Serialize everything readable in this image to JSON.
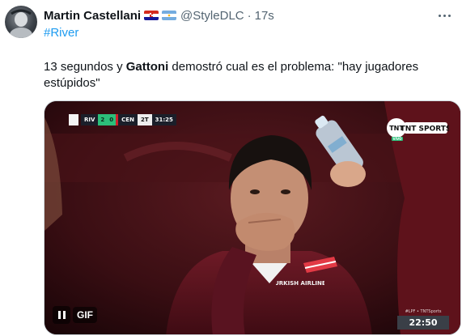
{
  "tweet": {
    "author": {
      "display_name": "Martin Castellani",
      "handle": "@StyleDLC",
      "flags": [
        "croatia-flag-icon",
        "argentina-flag-icon"
      ]
    },
    "separator": "·",
    "timestamp": "17s",
    "more_icon": "more-horizontal-icon",
    "hashtag": "#River",
    "text": {
      "before": "13 segundos y ",
      "bold": "Gattoni",
      "after": " demostró cual es el problema: \"hay jugadores estúpidos\""
    },
    "media": {
      "type": "GIF",
      "gif_label": "GIF",
      "pause_icon": "pause-icon",
      "scorebug": {
        "home": "RIV",
        "home_score": "2",
        "away_score": "0",
        "away": "CEN",
        "period": "2T",
        "clock": "31:25"
      },
      "broadcaster_logo": "TNT SPORTS",
      "broadcaster_sub": "VIVO",
      "shirt_text": "TURKISH AIRLINES",
      "ticker_label": "#LPF • TNTSports",
      "ticker_time": "22:50"
    }
  }
}
